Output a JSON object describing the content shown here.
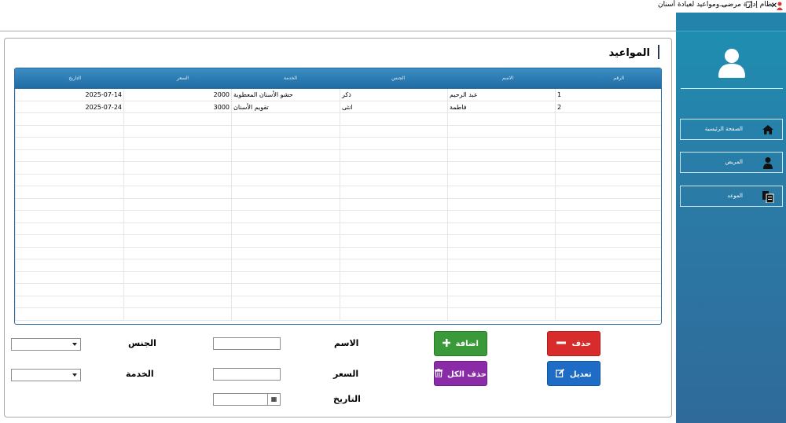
{
  "window": {
    "title": "نظام إدارة مرضى ومواعيد لعيادة أسنان",
    "controls": {
      "minimize": "—",
      "maximize": "❐",
      "close": "✕"
    }
  },
  "sidebar": {
    "avatar_icon": "user-icon",
    "items": [
      {
        "label": "الصفحة الرئيسية",
        "icon": "home-icon"
      },
      {
        "label": "المريض",
        "icon": "person-icon"
      },
      {
        "label": "الموعد",
        "icon": "documents-icon"
      }
    ]
  },
  "page": {
    "title": "المواعيد"
  },
  "table": {
    "columns": [
      "الرقم",
      "الاسم",
      "الجنس",
      "الخدمة",
      "السعر",
      "التاريخ"
    ],
    "rows": [
      [
        "1",
        "عبد الرحيم",
        "ذكر",
        "حشو الأسنان المعطوبة",
        "2000",
        "2025-07-14"
      ],
      [
        "2",
        "فاطمة",
        "انثى",
        "تقويم الأسنان",
        "3000",
        "2025-07-24"
      ]
    ]
  },
  "form": {
    "name_label": "الاسم",
    "gender_label": "الجنس",
    "price_label": "السعر",
    "service_label": "الخدمة",
    "date_label": "التاريخ",
    "name_value": "",
    "price_value": "",
    "gender_value": "",
    "service_value": "",
    "date_value": ""
  },
  "buttons": {
    "add": "اضافة",
    "delete": "حذف",
    "delete_all": "حذف الكل",
    "edit": "تعديل"
  },
  "colors": {
    "sidebar": "#2a7ca7",
    "table_header": "#1f6aa3",
    "add": "#3a9a3a",
    "delete": "#d82b2b",
    "delete_all": "#8a2ba8",
    "edit": "#1f6cc7"
  }
}
